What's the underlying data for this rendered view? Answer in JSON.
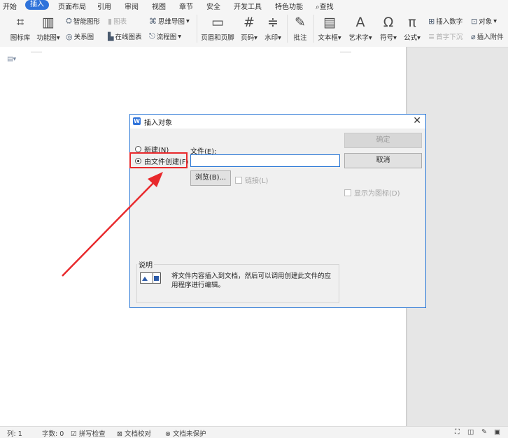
{
  "menu": {
    "items": [
      "开始",
      "插入",
      "页面布局",
      "引用",
      "审阅",
      "视图",
      "章节",
      "安全",
      "开发工具",
      "特色功能"
    ],
    "search": "查找",
    "active_index": 1
  },
  "ribbon": {
    "picture_lib": "图标库",
    "func_chart": "功能图",
    "smart_art": "智能图形",
    "chart": "图表",
    "relation_chart": "关系图",
    "online_chart": "在线图表",
    "mind_map": "思维导图",
    "flow_chart": "流程图",
    "header_footer": "页眉和页脚",
    "page_num": "页码",
    "watermark": "水印",
    "comment": "批注",
    "text_box": "文本框",
    "art_text": "艺术字",
    "symbol": "符号",
    "formula": "公式",
    "insert_number": "插入数字",
    "object": "对象",
    "drop_cap": "首字下沉",
    "attachment": "插入附件"
  },
  "dialog": {
    "title": "插入对象",
    "radio_new": "新建(N)",
    "radio_from_file": "由文件创建(F)",
    "file_label": "文件(E):",
    "file_value": "",
    "ok_button": "确定",
    "cancel_button": "取消",
    "browse_button": "浏览(B)...",
    "link_checkbox": "链接(L)",
    "display_icon_checkbox": "显示为图标(D)",
    "desc_title": "说明",
    "desc_text": "将文件内容插入到文档，然后可以调用创建此文件的应用程序进行编辑。"
  },
  "status": {
    "col": "列: 1",
    "word_count": "字数: 0",
    "spell_check": "拼写检查",
    "doc_proof": "文档校对",
    "doc_protect": "文档未保护"
  },
  "colors": {
    "accent": "#2f73da",
    "highlight": "#e8292c",
    "arrow": "#e8292c"
  }
}
